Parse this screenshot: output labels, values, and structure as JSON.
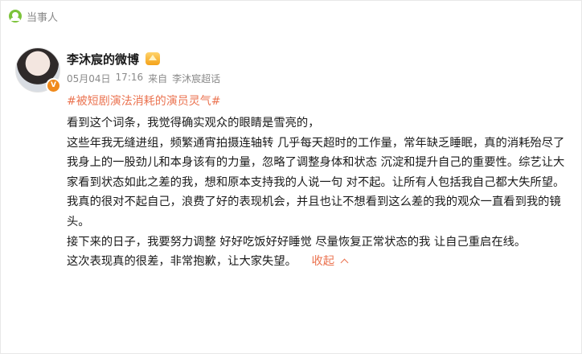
{
  "header": {
    "label": "当事人"
  },
  "post": {
    "author": "李沐宸的微博",
    "date": "05月04日",
    "time": "17:16",
    "source_prefix": "来自",
    "source": "李沐宸超话",
    "hashtag": "#被短剧演法消耗的演员灵气#",
    "paragraphs": [
      "看到这个词条，我觉得确实观众的眼睛是雪亮的，",
      "这些年我无缝进组，频繁通宵拍摄连轴转 几乎每天超时的工作量，常年缺乏睡眠，真的消耗殆尽了我身上的一股劲儿和本身该有的力量，忽略了调整身体和状态 沉淀和提升自己的重要性。综艺让大家看到状态如此之差的我，想和原本支持我的人说一句 对不起。让所有人包括我自己都大失所望。",
      "我真的很对不起自己，浪费了好的表现机会，并且也让不想看到这么差的我的观众一直看到我的镜头。",
      "接下来的日子，我要努力调整 好好吃饭好好睡觉 尽量恢复正常状态的我 让自己重启在线。",
      "这次表现真的很差，非常抱歉，让大家失望。"
    ],
    "collapse_label": "收起"
  },
  "colors": {
    "link": "#eb7350",
    "meta": "#8a8a8a",
    "brand": "#7cc33a"
  }
}
